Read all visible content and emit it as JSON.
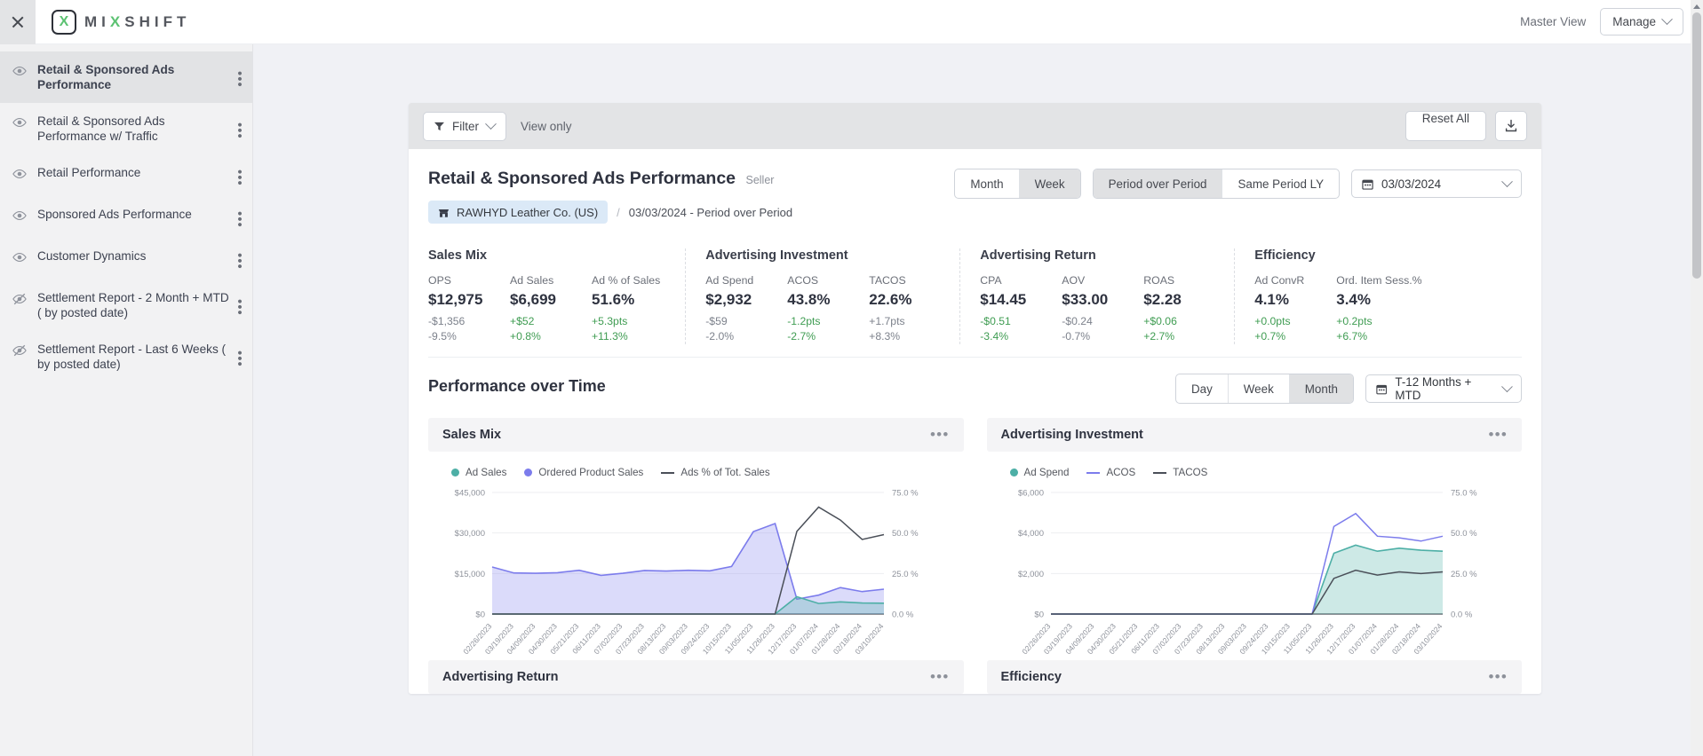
{
  "topbar": {
    "close_icon": "close-icon",
    "brand_mark": "X",
    "brand_name_1": "MI",
    "brand_name_x": "X",
    "brand_name_2": "SHIFT",
    "master_view_label": "Master View",
    "manage_label": "Manage"
  },
  "sidebar": {
    "items": [
      {
        "label": "Retail & Sponsored Ads Performance",
        "icon": "eye-icon",
        "active": true
      },
      {
        "label": "Retail & Sponsored Ads Performance w/ Traffic",
        "icon": "eye-icon",
        "active": false
      },
      {
        "label": "Retail Performance",
        "icon": "eye-icon",
        "active": false
      },
      {
        "label": "Sponsored Ads Performance",
        "icon": "eye-icon",
        "active": false
      },
      {
        "label": "Customer Dynamics",
        "icon": "eye-icon",
        "active": false
      },
      {
        "label": "Settlement Report - 2 Month + MTD ( by posted date)",
        "icon": "eye-off-icon",
        "active": false
      },
      {
        "label": "Settlement Report - Last 6 Weeks ( by posted date)",
        "icon": "eye-off-icon",
        "active": false
      }
    ]
  },
  "toolbar": {
    "filter_label": "Filter",
    "view_only_label": "View only",
    "reset_label": "Reset All",
    "download_icon": "download-icon"
  },
  "report": {
    "title": "Retail & Sponsored Ads Performance",
    "subtitle": "Seller",
    "seller_chip": "RAWHYD Leather Co. (US)",
    "separator": "/",
    "breadcrumb_date": "03/03/2024 - Period over Period",
    "granularity": [
      {
        "label": "Month",
        "selected": false
      },
      {
        "label": "Week",
        "selected": true
      }
    ],
    "comparison": [
      {
        "label": "Period over Period",
        "selected": true
      },
      {
        "label": "Same Period LY",
        "selected": false
      }
    ],
    "date_value": "03/03/2024"
  },
  "kpi_groups": [
    {
      "title": "Sales Mix",
      "metrics": [
        {
          "label": "OPS",
          "value": "$12,975",
          "delta1": "-$1,356",
          "delta1_sign": "neg",
          "delta2": "-9.5%",
          "delta2_sign": "neg"
        },
        {
          "label": "Ad Sales",
          "value": "$6,699",
          "delta1": "+$52",
          "delta1_sign": "pos",
          "delta2": "+0.8%",
          "delta2_sign": "pos"
        },
        {
          "label": "Ad % of Sales",
          "value": "51.6%",
          "delta1": "+5.3pts",
          "delta1_sign": "pos",
          "delta2": "+11.3%",
          "delta2_sign": "pos"
        }
      ]
    },
    {
      "title": "Advertising Investment",
      "metrics": [
        {
          "label": "Ad Spend",
          "value": "$2,932",
          "delta1": "-$59",
          "delta1_sign": "neg",
          "delta2": "-2.0%",
          "delta2_sign": "neg"
        },
        {
          "label": "ACOS",
          "value": "43.8%",
          "delta1": "-1.2pts",
          "delta1_sign": "pos",
          "delta2": "-2.7%",
          "delta2_sign": "pos"
        },
        {
          "label": "TACOS",
          "value": "22.6%",
          "delta1": "+1.7pts",
          "delta1_sign": "neg",
          "delta2": "+8.3%",
          "delta2_sign": "neg"
        }
      ]
    },
    {
      "title": "Advertising Return",
      "metrics": [
        {
          "label": "CPA",
          "value": "$14.45",
          "delta1": "-$0.51",
          "delta1_sign": "pos",
          "delta2": "-3.4%",
          "delta2_sign": "pos"
        },
        {
          "label": "AOV",
          "value": "$33.00",
          "delta1": "-$0.24",
          "delta1_sign": "neg",
          "delta2": "-0.7%",
          "delta2_sign": "neg"
        },
        {
          "label": "ROAS",
          "value": "$2.28",
          "delta1": "+$0.06",
          "delta1_sign": "pos",
          "delta2": "+2.7%",
          "delta2_sign": "pos"
        }
      ]
    },
    {
      "title": "Efficiency",
      "metrics": [
        {
          "label": "Ad ConvR",
          "value": "4.1%",
          "delta1": "+0.0pts",
          "delta1_sign": "pos",
          "delta2": "+0.7%",
          "delta2_sign": "pos"
        },
        {
          "label": "Ord. Item Sess.%",
          "value": "3.4%",
          "delta1": "+0.2pts",
          "delta1_sign": "pos",
          "delta2": "+6.7%",
          "delta2_sign": "pos"
        }
      ]
    }
  ],
  "performance": {
    "section_title": "Performance over Time",
    "granularity": [
      {
        "label": "Day",
        "selected": false
      },
      {
        "label": "Week",
        "selected": false
      },
      {
        "label": "Month",
        "selected": true
      }
    ],
    "range_value": "T-12 Months + MTD"
  },
  "panels": [
    {
      "title": "Advertising Return",
      "menu_icon": "ellipsis-icon"
    },
    {
      "title": "Efficiency",
      "menu_icon": "ellipsis-icon"
    }
  ],
  "colors": {
    "teal": "#4dafa6",
    "purple": "#7c7cec",
    "dark_line": "#4a4f58",
    "green": "#3f9c52",
    "chip_blue": "#dbe9f7"
  },
  "chart_data": [
    {
      "type": "area",
      "title": "Sales Mix",
      "xlabel": "",
      "ylabel": "",
      "ylim": [
        0,
        45000
      ],
      "y2lim": [
        0,
        75
      ],
      "yticks": [
        "$0",
        "$15,000",
        "$30,000",
        "$45,000"
      ],
      "y2ticks": [
        "0.0 %",
        "25.0 %",
        "50.0 %",
        "75.0 %"
      ],
      "grid": true,
      "legend_position": "top-left",
      "x": [
        "02/26/2023",
        "03/19/2023",
        "04/09/2023",
        "04/30/2023",
        "05/21/2023",
        "06/11/2023",
        "07/02/2023",
        "07/23/2023",
        "08/13/2023",
        "09/03/2023",
        "09/24/2023",
        "10/15/2023",
        "11/05/2023",
        "11/26/2023",
        "12/17/2023",
        "01/07/2024",
        "01/28/2024",
        "02/18/2024",
        "03/10/2024"
      ],
      "series": [
        {
          "name": "Ad Sales",
          "color": "#4dafa6",
          "axis": "left",
          "kind": "area",
          "values": [
            0,
            0,
            0,
            0,
            0,
            0,
            0,
            0,
            0,
            0,
            0,
            0,
            0,
            0,
            6400,
            3900,
            4500,
            4100,
            4000
          ]
        },
        {
          "name": "Ordered Product Sales",
          "color": "#7c7cec",
          "axis": "left",
          "kind": "area",
          "values": [
            17400,
            15200,
            15100,
            15300,
            16200,
            14300,
            15100,
            16100,
            15900,
            16200,
            16000,
            17600,
            30500,
            33500,
            5500,
            7000,
            9800,
            8300,
            9200
          ]
        },
        {
          "name": "Ads % of Tot. Sales",
          "color": "#4a4f58",
          "axis": "right",
          "kind": "line",
          "values": [
            0,
            0,
            0,
            0,
            0,
            0,
            0,
            0,
            0,
            0,
            0,
            0,
            0,
            0,
            51,
            66,
            58,
            46,
            49
          ]
        }
      ]
    },
    {
      "type": "area",
      "title": "Advertising Investment",
      "xlabel": "",
      "ylabel": "",
      "ylim": [
        0,
        6000
      ],
      "y2lim": [
        0,
        75
      ],
      "yticks": [
        "$0",
        "$2,000",
        "$4,000",
        "$6,000"
      ],
      "y2ticks": [
        "0.0 %",
        "25.0 %",
        "50.0 %",
        "75.0 %"
      ],
      "grid": true,
      "legend_position": "top-left",
      "x": [
        "02/26/2023",
        "03/19/2023",
        "04/09/2023",
        "04/30/2023",
        "05/21/2023",
        "06/11/2023",
        "07/02/2023",
        "07/23/2023",
        "08/13/2023",
        "09/03/2023",
        "09/24/2023",
        "10/15/2023",
        "11/05/2023",
        "11/26/2023",
        "12/17/2023",
        "01/07/2024",
        "01/28/2024",
        "02/18/2024",
        "03/10/2024"
      ],
      "series": [
        {
          "name": "Ad Spend",
          "color": "#4dafa6",
          "axis": "left",
          "kind": "area",
          "values": [
            0,
            0,
            0,
            0,
            0,
            0,
            0,
            0,
            0,
            0,
            0,
            0,
            0,
            3000,
            3400,
            3100,
            3250,
            3150,
            3100
          ]
        },
        {
          "name": "ACOS",
          "color": "#7c7cec",
          "axis": "right",
          "kind": "line",
          "values": [
            0,
            0,
            0,
            0,
            0,
            0,
            0,
            0,
            0,
            0,
            0,
            0,
            0,
            54,
            62,
            48,
            47,
            45,
            48
          ]
        },
        {
          "name": "TACOS",
          "color": "#4a4f58",
          "axis": "right",
          "kind": "line",
          "values": [
            0,
            0,
            0,
            0,
            0,
            0,
            0,
            0,
            0,
            0,
            0,
            0,
            0,
            22,
            27,
            24,
            26,
            25,
            26
          ]
        }
      ]
    }
  ]
}
